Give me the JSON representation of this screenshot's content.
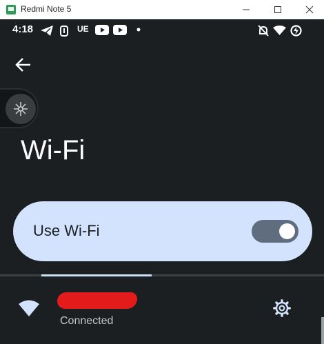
{
  "window": {
    "title": "Redmi Note 5"
  },
  "status_bar": {
    "time": "4:18",
    "left_icons": [
      "telegram-icon",
      "sync-icon",
      "ue-icon",
      "youtube-icon",
      "youtube-icon",
      "notification-dot-icon"
    ],
    "ue_text": "UE",
    "right_icons": [
      "bell-off-icon",
      "wifi-icon",
      "battery-charging-icon"
    ]
  },
  "page": {
    "title": "Wi-Fi",
    "use_wifi_label": "Use Wi-Fi",
    "use_wifi_enabled": true,
    "network": {
      "status": "Connected"
    }
  },
  "colors": {
    "accent_card": "#d3e3fd",
    "switch_track": "#5f6d7f",
    "background": "#1b1f21",
    "redaction": "#e31b1b"
  }
}
